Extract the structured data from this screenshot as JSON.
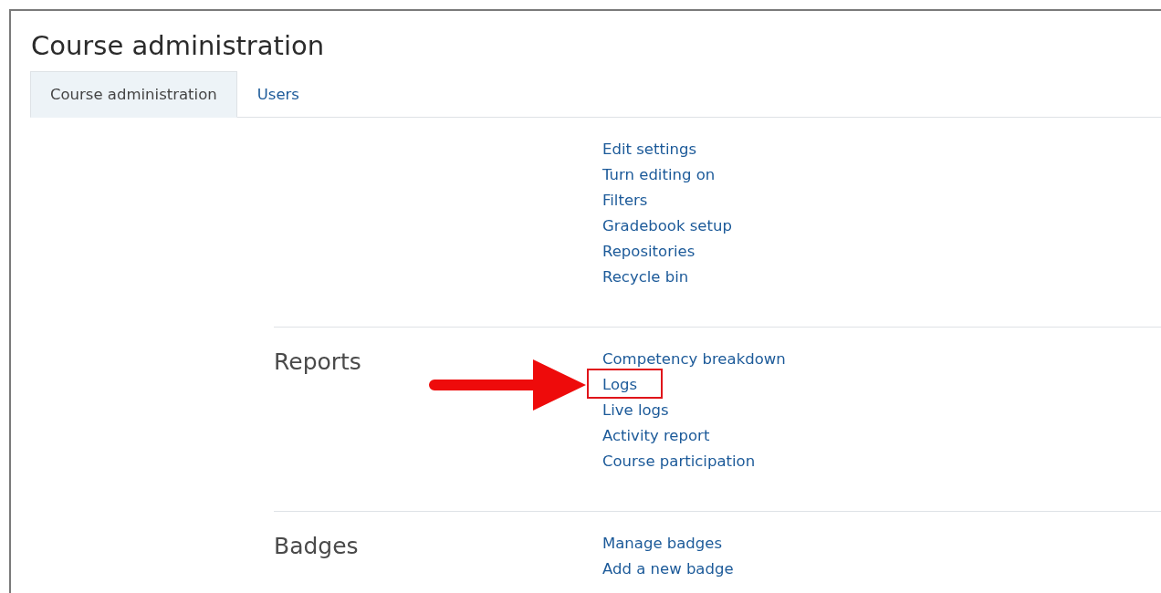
{
  "title": "Course administration",
  "tabs": [
    {
      "label": "Course administration",
      "selected": true
    },
    {
      "label": "Users",
      "selected": false
    }
  ],
  "sections": [
    {
      "links": [
        {
          "label": "Edit settings",
          "highlighted": false
        },
        {
          "label": "Turn editing on",
          "highlighted": false
        },
        {
          "label": "Filters",
          "highlighted": false
        },
        {
          "label": "Gradebook setup",
          "highlighted": false
        },
        {
          "label": "Repositories",
          "highlighted": false
        },
        {
          "label": "Recycle bin",
          "highlighted": false
        }
      ]
    },
    {
      "heading": "Reports",
      "links": [
        {
          "label": "Competency breakdown",
          "highlighted": false
        },
        {
          "label": "Logs",
          "highlighted": true
        },
        {
          "label": "Live logs",
          "highlighted": false
        },
        {
          "label": "Activity report",
          "highlighted": false
        },
        {
          "label": "Course participation",
          "highlighted": false
        }
      ]
    },
    {
      "heading": "Badges",
      "links": [
        {
          "label": "Manage badges",
          "highlighted": false
        },
        {
          "label": "Add a new badge",
          "highlighted": false
        }
      ]
    }
  ]
}
